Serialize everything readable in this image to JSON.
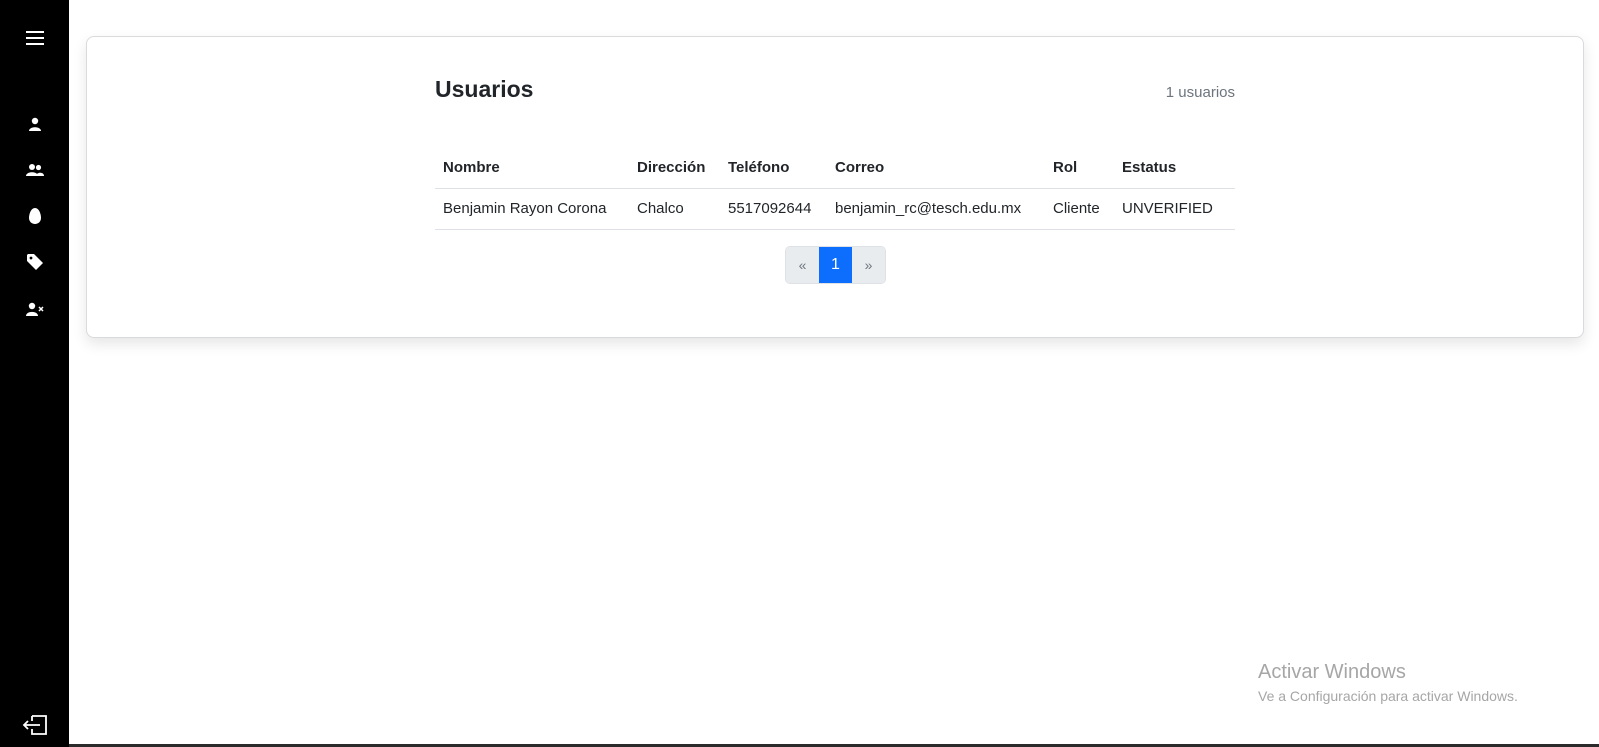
{
  "sidebar": {
    "icons": [
      "menu-icon",
      "user-icon",
      "users-icon",
      "egg-icon",
      "tag-icon",
      "user-x-icon",
      "logout-icon"
    ]
  },
  "main": {
    "title": "Usuarios",
    "count_label": "1 usuarios",
    "table": {
      "headers": [
        "Nombre",
        "Dirección",
        "Teléfono",
        "Correo",
        "Rol",
        "Estatus"
      ],
      "rows": [
        [
          "Benjamin Rayon Corona",
          "Chalco",
          "5517092644",
          "benjamin_rc@tesch.edu.mx",
          "Cliente",
          "UNVERIFIED"
        ]
      ]
    },
    "pagination": {
      "prev": "«",
      "current": "1",
      "next": "»"
    }
  },
  "watermark": {
    "title": "Activar Windows",
    "subtitle": "Ve a Configuración para activar Windows."
  },
  "colors": {
    "sidebar_bg": "#000000",
    "accent": "#0d6efd"
  }
}
